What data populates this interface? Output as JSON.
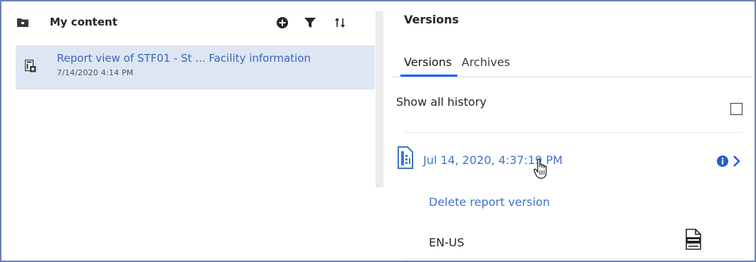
{
  "left_panel": {
    "title": "My content",
    "icons": {
      "folder": "folder-icon",
      "add": "add-circle-icon",
      "filter": "filter-icon",
      "sort": "sort-icon"
    },
    "items": [
      {
        "title": "Report view of STF01 - St ... Facility information",
        "date": "7/14/2020 4:14 PM",
        "icon": "report-view-icon"
      }
    ]
  },
  "right_panel": {
    "title": "Versions",
    "tabs": [
      {
        "label": "Versions",
        "selected": true
      },
      {
        "label": "Archives",
        "selected": false
      }
    ],
    "show_history": {
      "label": "Show all history",
      "checked": false
    },
    "version": {
      "date": "Jul 14, 2020, 4:37:19 PM",
      "icons": {
        "document": "report-document-icon",
        "info": "info-icon",
        "expand": "chevron-right-icon"
      },
      "actions": {
        "delete_label": "Delete report version"
      },
      "output": {
        "language": "EN-US",
        "format_icon": "html-file-icon"
      }
    }
  },
  "colors": {
    "accent": "#0f62fe",
    "link": "#3f74c9",
    "selection": "#dde6f2",
    "frame": "#6f7fb3"
  }
}
